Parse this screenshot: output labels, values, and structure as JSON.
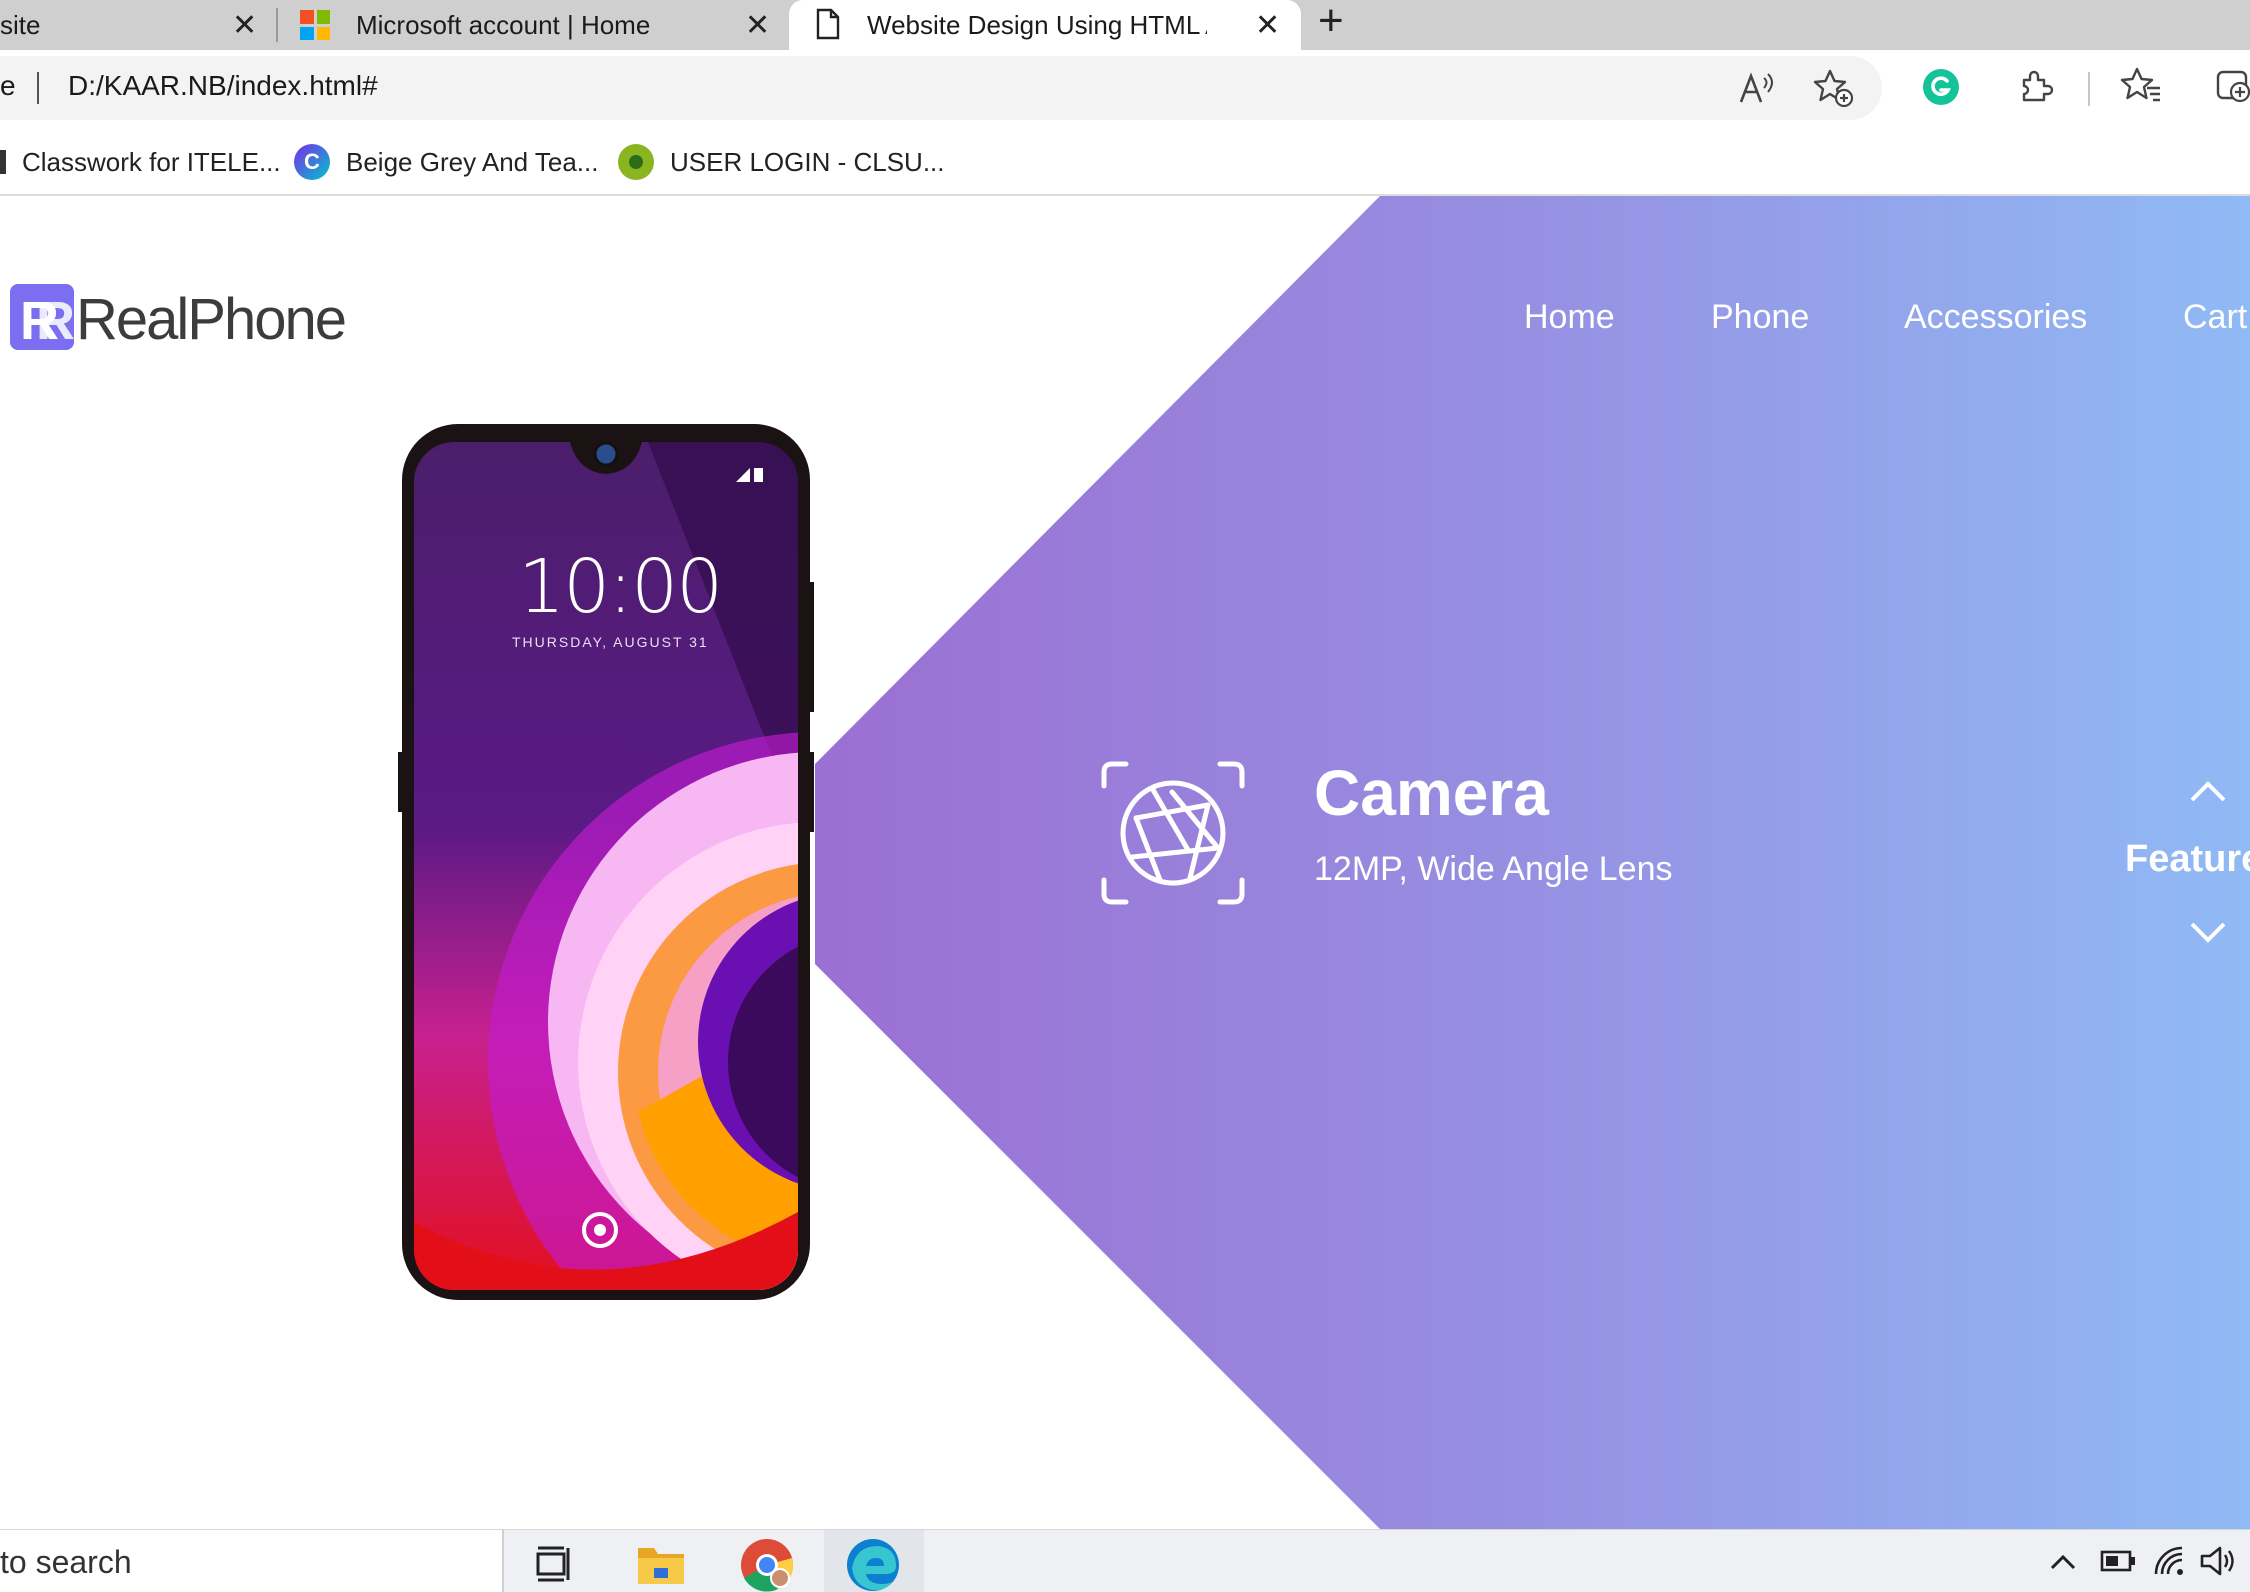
{
  "browser": {
    "tabs": [
      {
        "label": "site",
        "close": "✕"
      },
      {
        "label": "Microsoft account | Home",
        "close": "✕"
      },
      {
        "label": "Website Design Using HTML And",
        "close": "✕"
      }
    ],
    "new_tab": "+",
    "address": {
      "left_text": "e",
      "url": "D:/KAAR.NB/index.html#"
    },
    "bookmarks": [
      {
        "label": "Classwork for ITELE..."
      },
      {
        "label": "Beige Grey And Tea..."
      },
      {
        "label": "USER LOGIN - CLSU..."
      }
    ],
    "colors": {
      "grammarly": "#15c39a",
      "tabbar": "#cfcfcf"
    }
  },
  "site": {
    "logo": {
      "mark": "R",
      "text": "RealPhone"
    },
    "nav": [
      {
        "label": "Home"
      },
      {
        "label": "Phone"
      },
      {
        "label": "Accessories"
      },
      {
        "label": "Cart"
      }
    ],
    "phone": {
      "time": "10:00",
      "date": "THURSDAY, AUGUST 31"
    },
    "feature": {
      "icon": "camera-aperture-icon",
      "title": "Camera",
      "subtitle": "12MP, Wide Angle Lens"
    },
    "side_control": {
      "label": "Features",
      "up": "chevron-up-icon",
      "down": "chevron-down-icon"
    },
    "colors": {
      "gradient_start": "#9673d5",
      "gradient_end": "#90b8f4",
      "logo_mark": "#7b6ef0"
    }
  },
  "taskbar": {
    "search_text": "to search"
  }
}
